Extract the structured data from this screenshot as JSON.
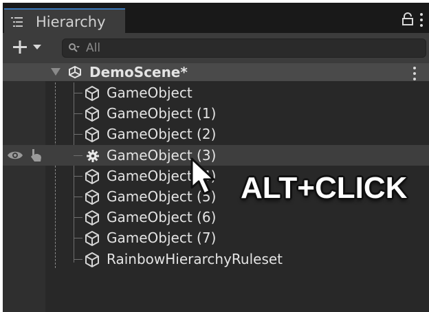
{
  "window": {
    "tab_title": "Hierarchy",
    "tab_icon": "list-icon",
    "lock_icon": "lock-icon",
    "menu_icon": "kebab-menu-icon"
  },
  "toolbar": {
    "add_icon": "plus-dropdown-icon",
    "search_icon": "search-icon",
    "search_placeholder": "All"
  },
  "scene": {
    "title": "DemoScene*",
    "icon": "unity-scene-icon",
    "menu_icon": "kebab-menu-icon"
  },
  "items": [
    {
      "label": "GameObject",
      "icon": "cube-icon"
    },
    {
      "label": "GameObject (1)",
      "icon": "cube-icon"
    },
    {
      "label": "GameObject (2)",
      "icon": "cube-icon"
    },
    {
      "label": "GameObject (3)",
      "icon": "gear-icon",
      "selected": true
    },
    {
      "label": "GameObject (4)",
      "icon": "cube-icon"
    },
    {
      "label": "GameObject (5)",
      "icon": "cube-icon"
    },
    {
      "label": "GameObject (6)",
      "icon": "cube-icon"
    },
    {
      "label": "GameObject (7)",
      "icon": "cube-icon"
    },
    {
      "label": "RainbowHierarchyRuleset",
      "icon": "cube-icon"
    }
  ],
  "row_controls": {
    "visibility_icon": "eye-icon",
    "pickability_icon": "hand-pointer-icon"
  },
  "overlay": {
    "text": "ALT+CLICK",
    "cursor_icon": "mouse-cursor-icon"
  },
  "colors": {
    "tab_accent": "#3a79bb",
    "panel_bg": "#282828",
    "text": "#e4e4e4"
  }
}
